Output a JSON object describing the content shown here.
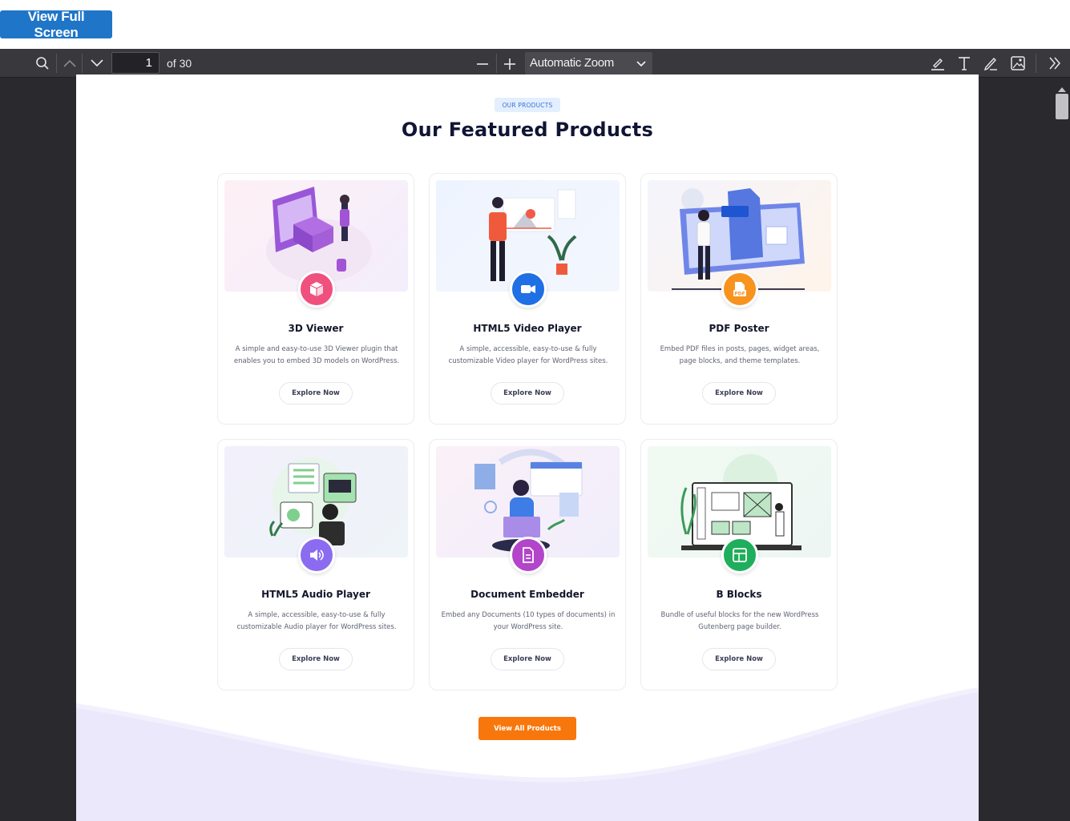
{
  "fullscreen_button": {
    "label": "View Full Screen"
  },
  "toolbar": {
    "page_number": "1",
    "page_count": "of 30",
    "zoom_value": "Automatic Zoom",
    "icons": [
      "search-icon",
      "chevron-up-icon",
      "chevron-down-icon",
      "zoom-out-icon",
      "zoom-in-icon",
      "highlight-icon",
      "text-icon",
      "draw-icon",
      "image-icon",
      "double-chevron-right-icon"
    ]
  },
  "page": {
    "badge": "OUR PRODUCTS",
    "heading": "Our Featured Products",
    "view_all": "View All Products",
    "products": [
      {
        "title": "3D Viewer",
        "desc": "A simple and easy-to-use 3D Viewer plugin that enables you to embed 3D models on WordPress.",
        "button": "Explore Now",
        "icon": "cube-icon",
        "color": "#f0507e"
      },
      {
        "title": "HTML5 Video Player",
        "desc": "A simple, accessible, easy-to-use & fully customizable Video player for WordPress sites.",
        "button": "Explore Now",
        "icon": "video-camera-icon",
        "color": "#1f6fe5"
      },
      {
        "title": "PDF Poster",
        "desc": "Embed PDF files in posts, pages, widget areas, page blocks, and theme templates.",
        "button": "Explore Now",
        "icon": "pdf-file-icon",
        "color": "#f7931e"
      },
      {
        "title": "HTML5 Audio Player",
        "desc": "A simple, accessible, easy-to-use & fully customizable Audio player for WordPress sites.",
        "button": "Explore Now",
        "icon": "speaker-icon",
        "color": "#8b6cf0"
      },
      {
        "title": "Document Embedder",
        "desc": "Embed any Documents (10 types of documents) in your WordPress site.",
        "button": "Explore Now",
        "icon": "document-icon",
        "color": "#b245c9"
      },
      {
        "title": "B Blocks",
        "desc": "Bundle of useful blocks for the new WordPress Gutenberg page builder.",
        "button": "Explore Now",
        "icon": "layout-blocks-icon",
        "color": "#1fae5b"
      }
    ]
  }
}
